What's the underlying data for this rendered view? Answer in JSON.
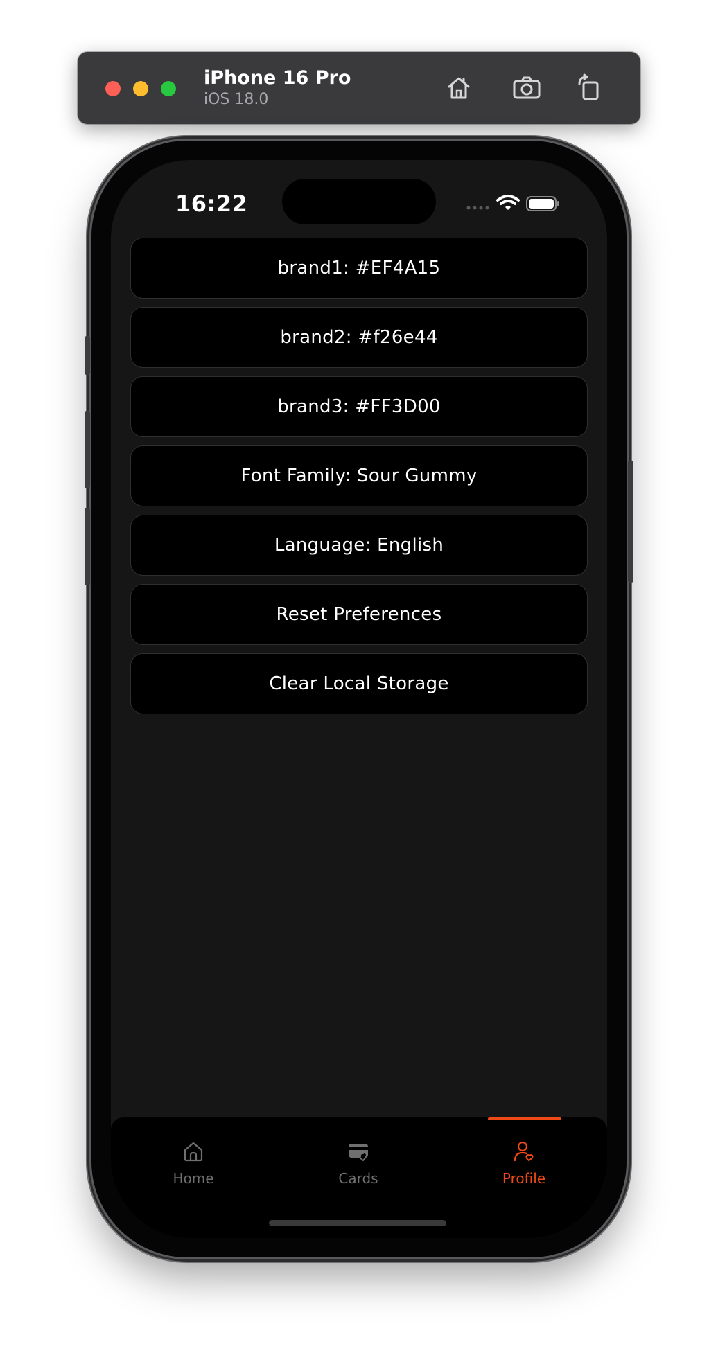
{
  "simulator": {
    "device_name": "iPhone 16 Pro",
    "os_version": "iOS 18.0",
    "icons": [
      "home-icon",
      "screenshot-icon",
      "rotate-icon"
    ]
  },
  "status_bar": {
    "time": "16:22",
    "icons": [
      "cellular-icon",
      "wifi-icon",
      "battery-icon"
    ]
  },
  "preferences": [
    {
      "label": "brand1: #EF4A15"
    },
    {
      "label": "brand2: #f26e44"
    },
    {
      "label": "brand3: #FF3D00"
    },
    {
      "label": "Font Family: Sour Gummy"
    },
    {
      "label": "Language: English"
    },
    {
      "label": "Reset Preferences"
    },
    {
      "label": "Clear Local Storage"
    }
  ],
  "tab_bar": {
    "tabs": [
      {
        "label": "Home",
        "icon": "home-icon",
        "active": false
      },
      {
        "label": "Cards",
        "icon": "cards-icon",
        "active": false
      },
      {
        "label": "Profile",
        "icon": "profile-icon",
        "active": true
      }
    ]
  },
  "colors": {
    "accent": "#EF4A15",
    "background": "#161616",
    "row_background": "#000000",
    "inactive_tab": "#6f6f6f"
  }
}
